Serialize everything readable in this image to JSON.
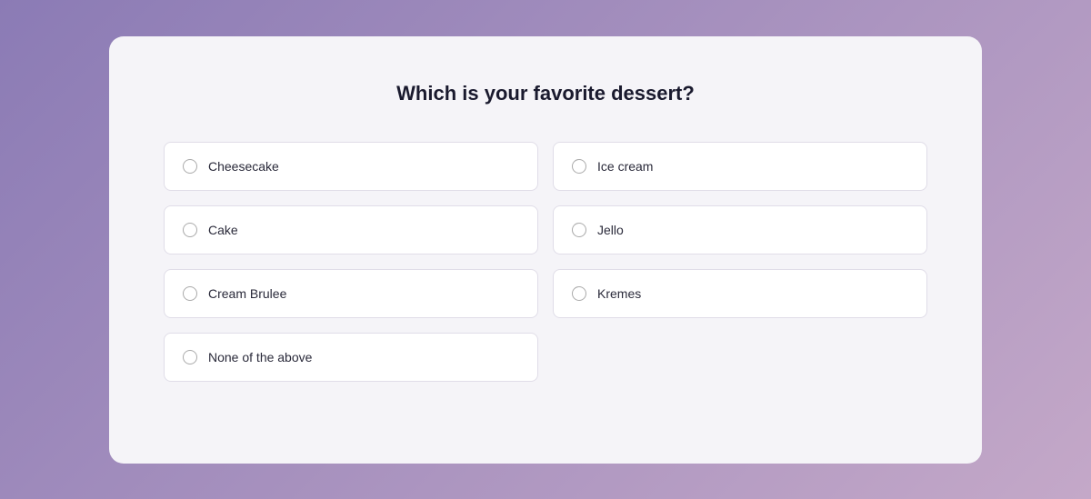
{
  "page": {
    "background": "linear-gradient(135deg, #8b7bb5, #c4a8c8)"
  },
  "survey": {
    "title": "Which is your favorite dessert?",
    "options": [
      {
        "id": "cheesecake",
        "label": "Cheesecake",
        "col": "left"
      },
      {
        "id": "ice-cream",
        "label": "Ice cream",
        "col": "right"
      },
      {
        "id": "cake",
        "label": "Cake",
        "col": "left"
      },
      {
        "id": "jello",
        "label": "Jello",
        "col": "right"
      },
      {
        "id": "cream-brulee",
        "label": "Cream Brulee",
        "col": "left"
      },
      {
        "id": "kremes",
        "label": "Kremes",
        "col": "right"
      },
      {
        "id": "none-of-the-above",
        "label": "None of the above",
        "col": "left-only"
      }
    ]
  }
}
